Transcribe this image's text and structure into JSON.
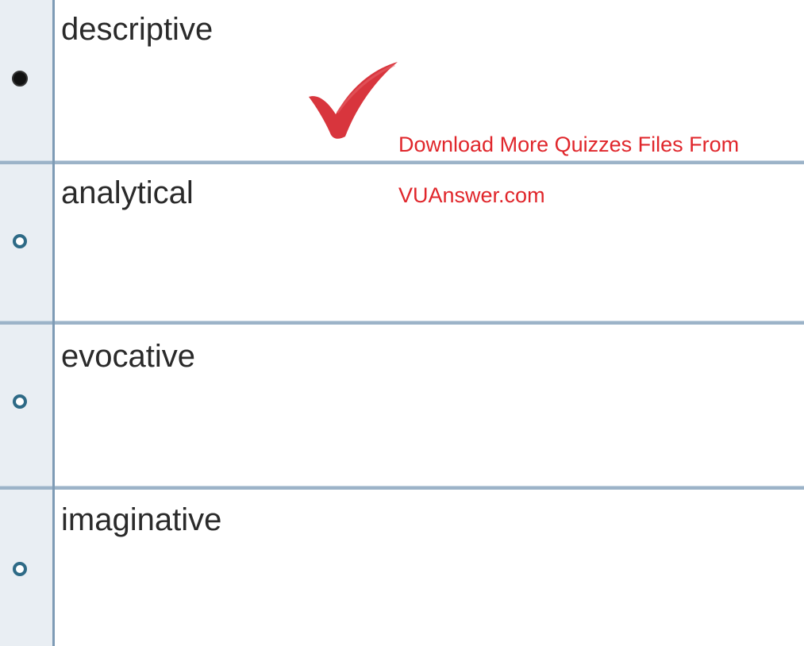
{
  "quiz": {
    "options": [
      {
        "label": "descriptive",
        "selected": true
      },
      {
        "label": "analytical",
        "selected": false
      },
      {
        "label": "evocative",
        "selected": false
      },
      {
        "label": "imaginative",
        "selected": false
      }
    ],
    "correct_marker_icon": "checkmark-icon"
  },
  "watermark": {
    "line1": "Download More Quizzes Files From",
    "line2": "VUAnswer.com",
    "color": "#e0262b"
  },
  "colors": {
    "radio_unselected": "#2e6a86",
    "radio_selected": "#111111",
    "divider": "#9cb3c8",
    "checkmark": "#d8353d"
  }
}
